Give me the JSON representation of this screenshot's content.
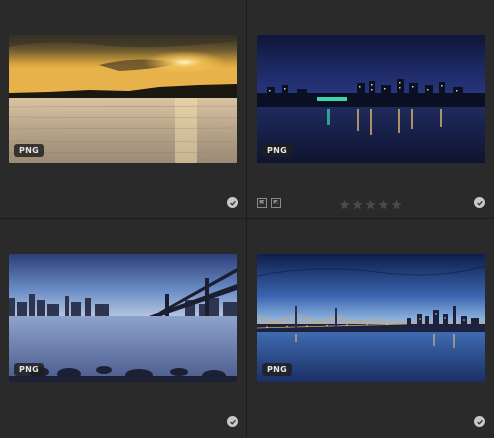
{
  "grid": {
    "cells": [
      {
        "format_badge": "PNG",
        "image": "sunset-lake-photo",
        "picked": true
      },
      {
        "format_badge": "PNG",
        "image": "city-skyline-night-photo",
        "picked": true,
        "rating": 0,
        "max_rating": 5
      },
      {
        "format_badge": "PNG",
        "image": "bridge-river-dusk-photo",
        "picked": true
      },
      {
        "format_badge": "PNG",
        "image": "bay-bridge-twilight-photo",
        "picked": true
      }
    ]
  },
  "colors": {
    "background": "#2a2a2a",
    "divider": "#1c1c1c",
    "badge_bg": "#1e1e1e",
    "badge_text": "#e6e6e6",
    "check": "#c8c8c8",
    "star_empty": "#4a4a4a"
  },
  "icons": {
    "pick": "checkmark-circle-icon",
    "flag_pick": "pick-flag-icon",
    "flag_reject": "reject-flag-icon",
    "star": "star-icon"
  }
}
